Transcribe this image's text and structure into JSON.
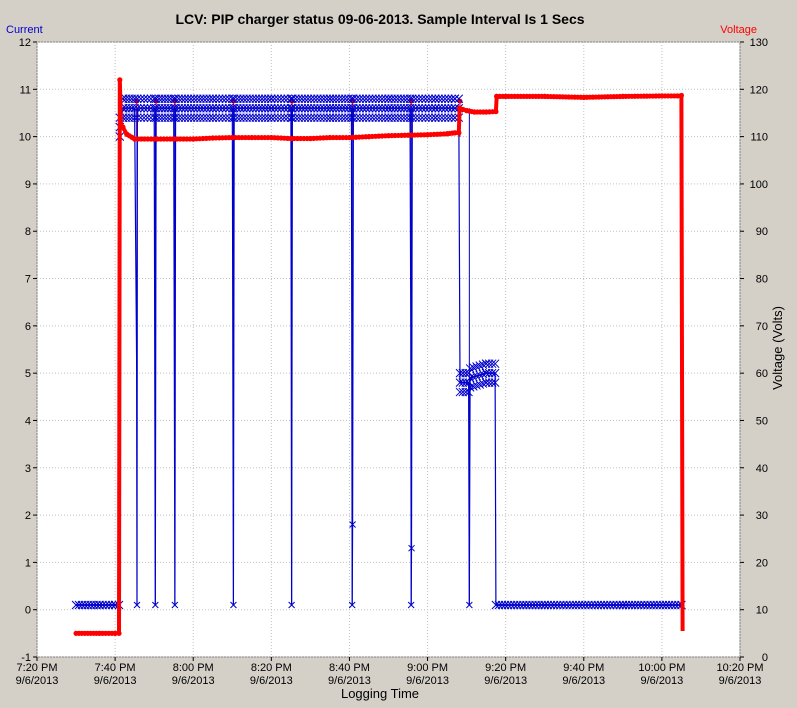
{
  "chart_data": {
    "type": "line",
    "title": "LCV: PIP charger status 09-06-2013.  Sample Interval Is 1 Secs",
    "xlabel": "Logging Time",
    "ylabel_left": "",
    "ylabel_right": "Voltage (Volts)",
    "legend": {
      "left": "Current",
      "right": "Voltage"
    },
    "colors": {
      "current": "#0000cc",
      "voltage": "#ff0000",
      "plot_bg": "#ffffff",
      "frame_bg": "#d4d0c8"
    },
    "x_ticks": [
      {
        "t": 0,
        "time": "7:20 PM",
        "date": "9/6/2013"
      },
      {
        "t": 20,
        "time": "7:40 PM",
        "date": "9/6/2013"
      },
      {
        "t": 40,
        "time": "8:00 PM",
        "date": "9/6/2013"
      },
      {
        "t": 60,
        "time": "8:20 PM",
        "date": "9/6/2013"
      },
      {
        "t": 80,
        "time": "8:40 PM",
        "date": "9/6/2013"
      },
      {
        "t": 100,
        "time": "9:00 PM",
        "date": "9/6/2013"
      },
      {
        "t": 120,
        "time": "9:20 PM",
        "date": "9/6/2013"
      },
      {
        "t": 140,
        "time": "9:40 PM",
        "date": "9/6/2013"
      },
      {
        "t": 160,
        "time": "10:00 PM",
        "date": "9/6/2013"
      },
      {
        "t": 180,
        "time": "10:20 PM",
        "date": "9/6/2013"
      }
    ],
    "xlim": [
      0,
      180
    ],
    "ylim_left": [
      -1,
      12
    ],
    "ylim_right": [
      0,
      130
    ],
    "y_ticks_left": [
      -1,
      0,
      1,
      2,
      3,
      4,
      5,
      6,
      7,
      8,
      9,
      10,
      11,
      12
    ],
    "y_ticks_right": [
      0,
      10,
      20,
      30,
      40,
      50,
      60,
      70,
      80,
      90,
      100,
      110,
      120,
      130
    ],
    "grid": true,
    "series": [
      {
        "name": "Current",
        "axis": "left",
        "marker": "x",
        "points": [
          [
            10,
            0.1
          ],
          [
            16,
            0.1
          ],
          [
            20,
            0.1
          ],
          [
            21,
            0.1
          ],
          [
            21.2,
            10.2
          ],
          [
            22,
            10.6
          ],
          [
            25,
            10.6
          ],
          [
            25.5,
            5.3
          ],
          [
            25.6,
            0.1
          ],
          [
            25.7,
            10.6
          ],
          [
            30,
            10.6
          ],
          [
            30.3,
            0.1
          ],
          [
            30.5,
            10.6
          ],
          [
            35,
            10.6
          ],
          [
            35.3,
            0.1
          ],
          [
            35.5,
            10.6
          ],
          [
            45,
            10.6
          ],
          [
            50,
            10.6
          ],
          [
            50.3,
            0.1
          ],
          [
            50.5,
            10.6
          ],
          [
            60,
            10.6
          ],
          [
            65,
            10.6
          ],
          [
            65.2,
            0.1
          ],
          [
            65.4,
            10.6
          ],
          [
            75,
            10.6
          ],
          [
            80.5,
            10.6
          ],
          [
            80.7,
            0.1
          ],
          [
            80.8,
            1.8
          ],
          [
            81,
            10.6
          ],
          [
            90,
            10.6
          ],
          [
            95.5,
            10.6
          ],
          [
            95.7,
            5.9
          ],
          [
            95.8,
            0.1
          ],
          [
            95.9,
            1.3
          ],
          [
            96.1,
            10.6
          ],
          [
            102,
            10.6
          ],
          [
            107,
            10.6
          ],
          [
            108,
            10.6
          ],
          [
            108.3,
            4.8
          ],
          [
            110.5,
            4.8
          ],
          [
            110.7,
            0.1
          ],
          [
            110.9,
            4.9
          ],
          [
            115,
            5.0
          ],
          [
            117.3,
            5.0
          ],
          [
            117.5,
            0.1
          ],
          [
            130,
            0.1
          ],
          [
            150,
            0.1
          ],
          [
            165,
            0.1
          ]
        ]
      },
      {
        "name": "Voltage",
        "axis": "right",
        "marker": "dot",
        "points": [
          [
            10,
            5
          ],
          [
            16,
            5
          ],
          [
            20,
            5
          ],
          [
            21,
            5
          ],
          [
            21.2,
            122
          ],
          [
            21.5,
            112.5
          ],
          [
            22,
            112.0
          ],
          [
            23,
            110.5
          ],
          [
            25,
            109.5
          ],
          [
            30,
            109.5
          ],
          [
            35,
            109.5
          ],
          [
            40,
            109.5
          ],
          [
            45,
            109.7
          ],
          [
            50,
            109.8
          ],
          [
            55,
            109.8
          ],
          [
            60,
            109.8
          ],
          [
            65,
            109.6
          ],
          [
            70,
            109.6
          ],
          [
            75,
            109.8
          ],
          [
            80,
            109.8
          ],
          [
            85,
            110.0
          ],
          [
            90,
            110.2
          ],
          [
            95,
            110.3
          ],
          [
            100,
            110.4
          ],
          [
            105,
            110.6
          ],
          [
            107,
            110.8
          ],
          [
            108,
            110.8
          ],
          [
            108.2,
            116.0
          ],
          [
            110,
            115.5
          ],
          [
            112,
            115.2
          ],
          [
            115,
            115.2
          ],
          [
            117.5,
            115.3
          ],
          [
            117.7,
            118.5
          ],
          [
            120,
            118.5
          ],
          [
            130,
            118.5
          ],
          [
            140,
            118.3
          ],
          [
            150,
            118.5
          ],
          [
            160,
            118.6
          ],
          [
            164,
            118.6
          ],
          [
            165,
            118.7
          ],
          [
            165.3,
            5.5
          ]
        ]
      }
    ],
    "spikes": {
      "current_drops_to_zero_at": [
        25.6,
        30.3,
        35.3,
        50.3,
        65.2,
        80.7,
        95.8,
        110.7
      ],
      "voltage_peaks_at": [
        25.5,
        30.5,
        35.3,
        50.3,
        65.3,
        80.8,
        95.8,
        108.3
      ],
      "voltage_peak_value": 117.5
    }
  }
}
